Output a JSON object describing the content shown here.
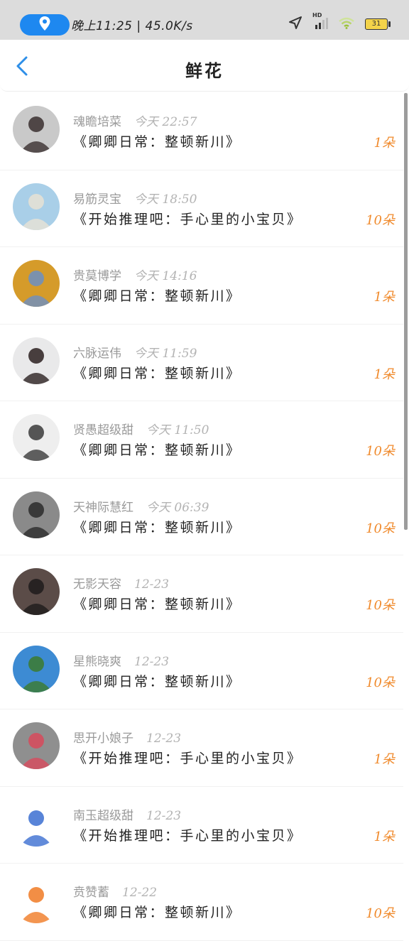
{
  "status_bar": {
    "time_speed": "晚上11:25 | 45.0K/s",
    "battery": "31",
    "hd_label": "HD"
  },
  "header": {
    "title": "鲜花"
  },
  "rows": [
    {
      "name": "魂瞻培菜",
      "time": "今天 22:57",
      "book": "《卿卿日常：整顿新川》",
      "count": "1朵",
      "avatar_colors": [
        "#c9c9c9",
        "#3a2f2f"
      ]
    },
    {
      "name": "易筋灵宝",
      "time": "今天 18:50",
      "book": "《开始推理吧：手心里的小宝贝》",
      "count": "10朵",
      "avatar_colors": [
        "#a9cfe8",
        "#e8e2d4"
      ]
    },
    {
      "name": "贵莫博学",
      "time": "今天 14:16",
      "book": "《卿卿日常：整顿新川》",
      "count": "1朵",
      "avatar_colors": [
        "#d59b2a",
        "#6b8fc4"
      ]
    },
    {
      "name": "六脉运伟",
      "time": "今天 11:59",
      "book": "《卿卿日常：整顿新川》",
      "count": "1朵",
      "avatar_colors": [
        "#e9e9ea",
        "#2b2020"
      ]
    },
    {
      "name": "贤愚超级甜",
      "time": "今天 11:50",
      "book": "《卿卿日常：整顿新川》",
      "count": "10朵",
      "avatar_colors": [
        "#eeeeee",
        "#3a3a3a"
      ]
    },
    {
      "name": "天神际慧红",
      "time": "今天 06:39",
      "book": "《卿卿日常：整顿新川》",
      "count": "10朵",
      "avatar_colors": [
        "#8a8a8a",
        "#2a2a2a"
      ]
    },
    {
      "name": "无影天容",
      "time": "12-23",
      "book": "《卿卿日常：整顿新川》",
      "count": "10朵",
      "avatar_colors": [
        "#5b4c48",
        "#1e1b1c"
      ]
    },
    {
      "name": "星熊晓爽",
      "time": "12-23",
      "book": "《卿卿日常：整顿新川》",
      "count": "10朵",
      "avatar_colors": [
        "#3d8bd3",
        "#3c7a2e"
      ]
    },
    {
      "name": "思开小娘子",
      "time": "12-23",
      "book": "《开始推理吧：手心里的小宝贝》",
      "count": "1朵",
      "avatar_colors": [
        "#8f8f8f",
        "#d84a5c"
      ]
    },
    {
      "name": "南玉超级甜",
      "time": "12-23",
      "book": "《开始推理吧：手心里的小宝贝》",
      "count": "1朵",
      "avatar_colors": [
        "#ffffff",
        "#3b6ed1"
      ]
    },
    {
      "name": "贲赞蓄",
      "time": "12-22",
      "book": "《卿卿日常：整顿新川》",
      "count": "10朵",
      "avatar_colors": [
        "#ffffff",
        "#f07a24"
      ]
    }
  ]
}
